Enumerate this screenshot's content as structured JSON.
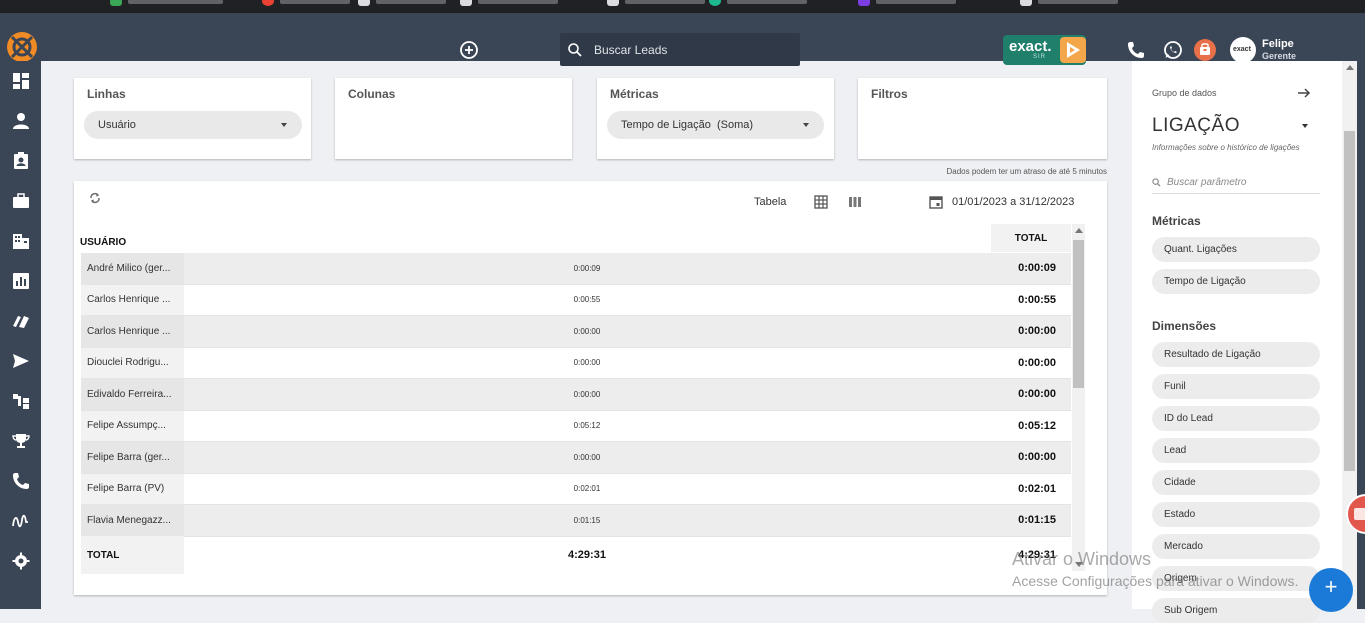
{
  "header": {
    "search_placeholder": "Buscar Leads",
    "brand_name": "exact.",
    "brand_sub": "SIR",
    "user_name": "Felipe",
    "user_role": "Gerente",
    "avatar_text": "exact"
  },
  "pivot": {
    "linhas_label": "Linhas",
    "linhas_value": "Usuário",
    "colunas_label": "Colunas",
    "metricas_label": "Métricas",
    "metricas_value": "Tempo de Ligação  (Soma)",
    "filtros_label": "Filtros",
    "delay_note": "Dados podem ter um atraso de até 5 minutos"
  },
  "table": {
    "view_label": "Tabela",
    "date_range": "01/01/2023 a 31/12/2023",
    "col_user": "USUÁRIO",
    "col_total": "TOTAL",
    "rows": [
      {
        "name": "André Milico (ger...",
        "value": "0:00:09",
        "total": "0:00:09"
      },
      {
        "name": "Carlos Henrique ...",
        "value": "0:00:55",
        "total": "0:00:55"
      },
      {
        "name": "Carlos Henrique ...",
        "value": "0:00:00",
        "total": "0:00:00"
      },
      {
        "name": "Diouclei Rodrigu...",
        "value": "0:00:00",
        "total": "0:00:00"
      },
      {
        "name": "Edivaldo Ferreira...",
        "value": "0:00:00",
        "total": "0:00:00"
      },
      {
        "name": "Felipe Assumpç...",
        "value": "0:05:12",
        "total": "0:05:12"
      },
      {
        "name": "Felipe Barra (ger...",
        "value": "0:00:00",
        "total": "0:00:00"
      },
      {
        "name": "Felipe Barra (PV)",
        "value": "0:02:01",
        "total": "0:02:01"
      },
      {
        "name": "Flavia Menegazz...",
        "value": "0:01:15",
        "total": "0:01:15"
      }
    ],
    "total_label": "TOTAL",
    "total_value": "4:29:31",
    "total_total": "4:29:31"
  },
  "right_panel": {
    "grupo_label": "Grupo de dados",
    "grupo_value": "LIGAÇÃO",
    "grupo_desc": "Informações sobre o histórico de ligações",
    "search_placeholder": "Buscar parâmetro",
    "metricas_title": "Métricas",
    "metricas": [
      "Quant. Ligações",
      "Tempo de Ligação"
    ],
    "dimensoes_title": "Dimensões",
    "dimensoes": [
      "Resultado de Ligação",
      "Funil",
      "ID do Lead",
      "Lead",
      "Cidade",
      "Estado",
      "Mercado",
      "Origem",
      "Sub Origem"
    ]
  },
  "watermark": {
    "title": "Ativar o Windows",
    "subtitle": "Acesse Configurações para ativar o Windows."
  },
  "colors": {
    "nav_bg": "#3a4556",
    "brand_green": "#1f7f6b",
    "fab_blue": "#1b7ad8",
    "logo_orange": "#f08a24"
  },
  "icons": [
    "add-circle-icon",
    "search-icon",
    "phone-icon",
    "whatsapp-icon",
    "notification-icon",
    "refresh-icon",
    "table-icon",
    "columns-icon",
    "calendar-icon",
    "arrow-right-icon"
  ]
}
